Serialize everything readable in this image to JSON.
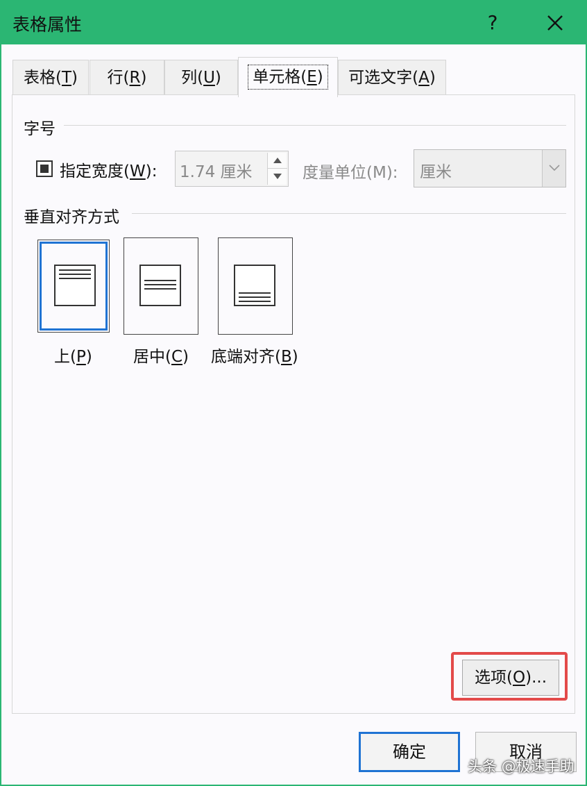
{
  "window": {
    "title": "表格属性",
    "help_glyph": "?",
    "accent_color": "#2bb673"
  },
  "tabs": [
    {
      "label": "表格(",
      "key": "T",
      "tail": ")",
      "active": false
    },
    {
      "label": "行(",
      "key": "R",
      "tail": ")",
      "active": false
    },
    {
      "label": "列(",
      "key": "U",
      "tail": ")",
      "active": false
    },
    {
      "label": "单元格(",
      "key": "E",
      "tail": ")",
      "active": true
    },
    {
      "label": "可选文字(",
      "key": "A",
      "tail": ")",
      "active": false
    }
  ],
  "size_section": {
    "label": "字号",
    "checkbox_checked": true,
    "width_label": "指定宽度(",
    "width_key": "W",
    "width_tail": "):",
    "width_value": "1.74 厘米",
    "unit_label": "度量单位(M):",
    "unit_value": "厘米"
  },
  "align_section": {
    "label": "垂直对齐方式",
    "options": [
      {
        "label": "上(",
        "key": "P",
        "tail": ")",
        "selected": true
      },
      {
        "label": "居中(",
        "key": "C",
        "tail": ")",
        "selected": false
      },
      {
        "label": "底端对齐(",
        "key": "B",
        "tail": ")",
        "selected": false
      }
    ],
    "selected_color": "#1f73d3"
  },
  "buttons": {
    "options_label": "选项(",
    "options_key": "O",
    "options_tail": ")...",
    "ok_label": "确定",
    "cancel_label": "取消"
  },
  "annotation": {
    "highlight_color": "#e34a4a"
  },
  "watermark": "头条 @极速手助"
}
